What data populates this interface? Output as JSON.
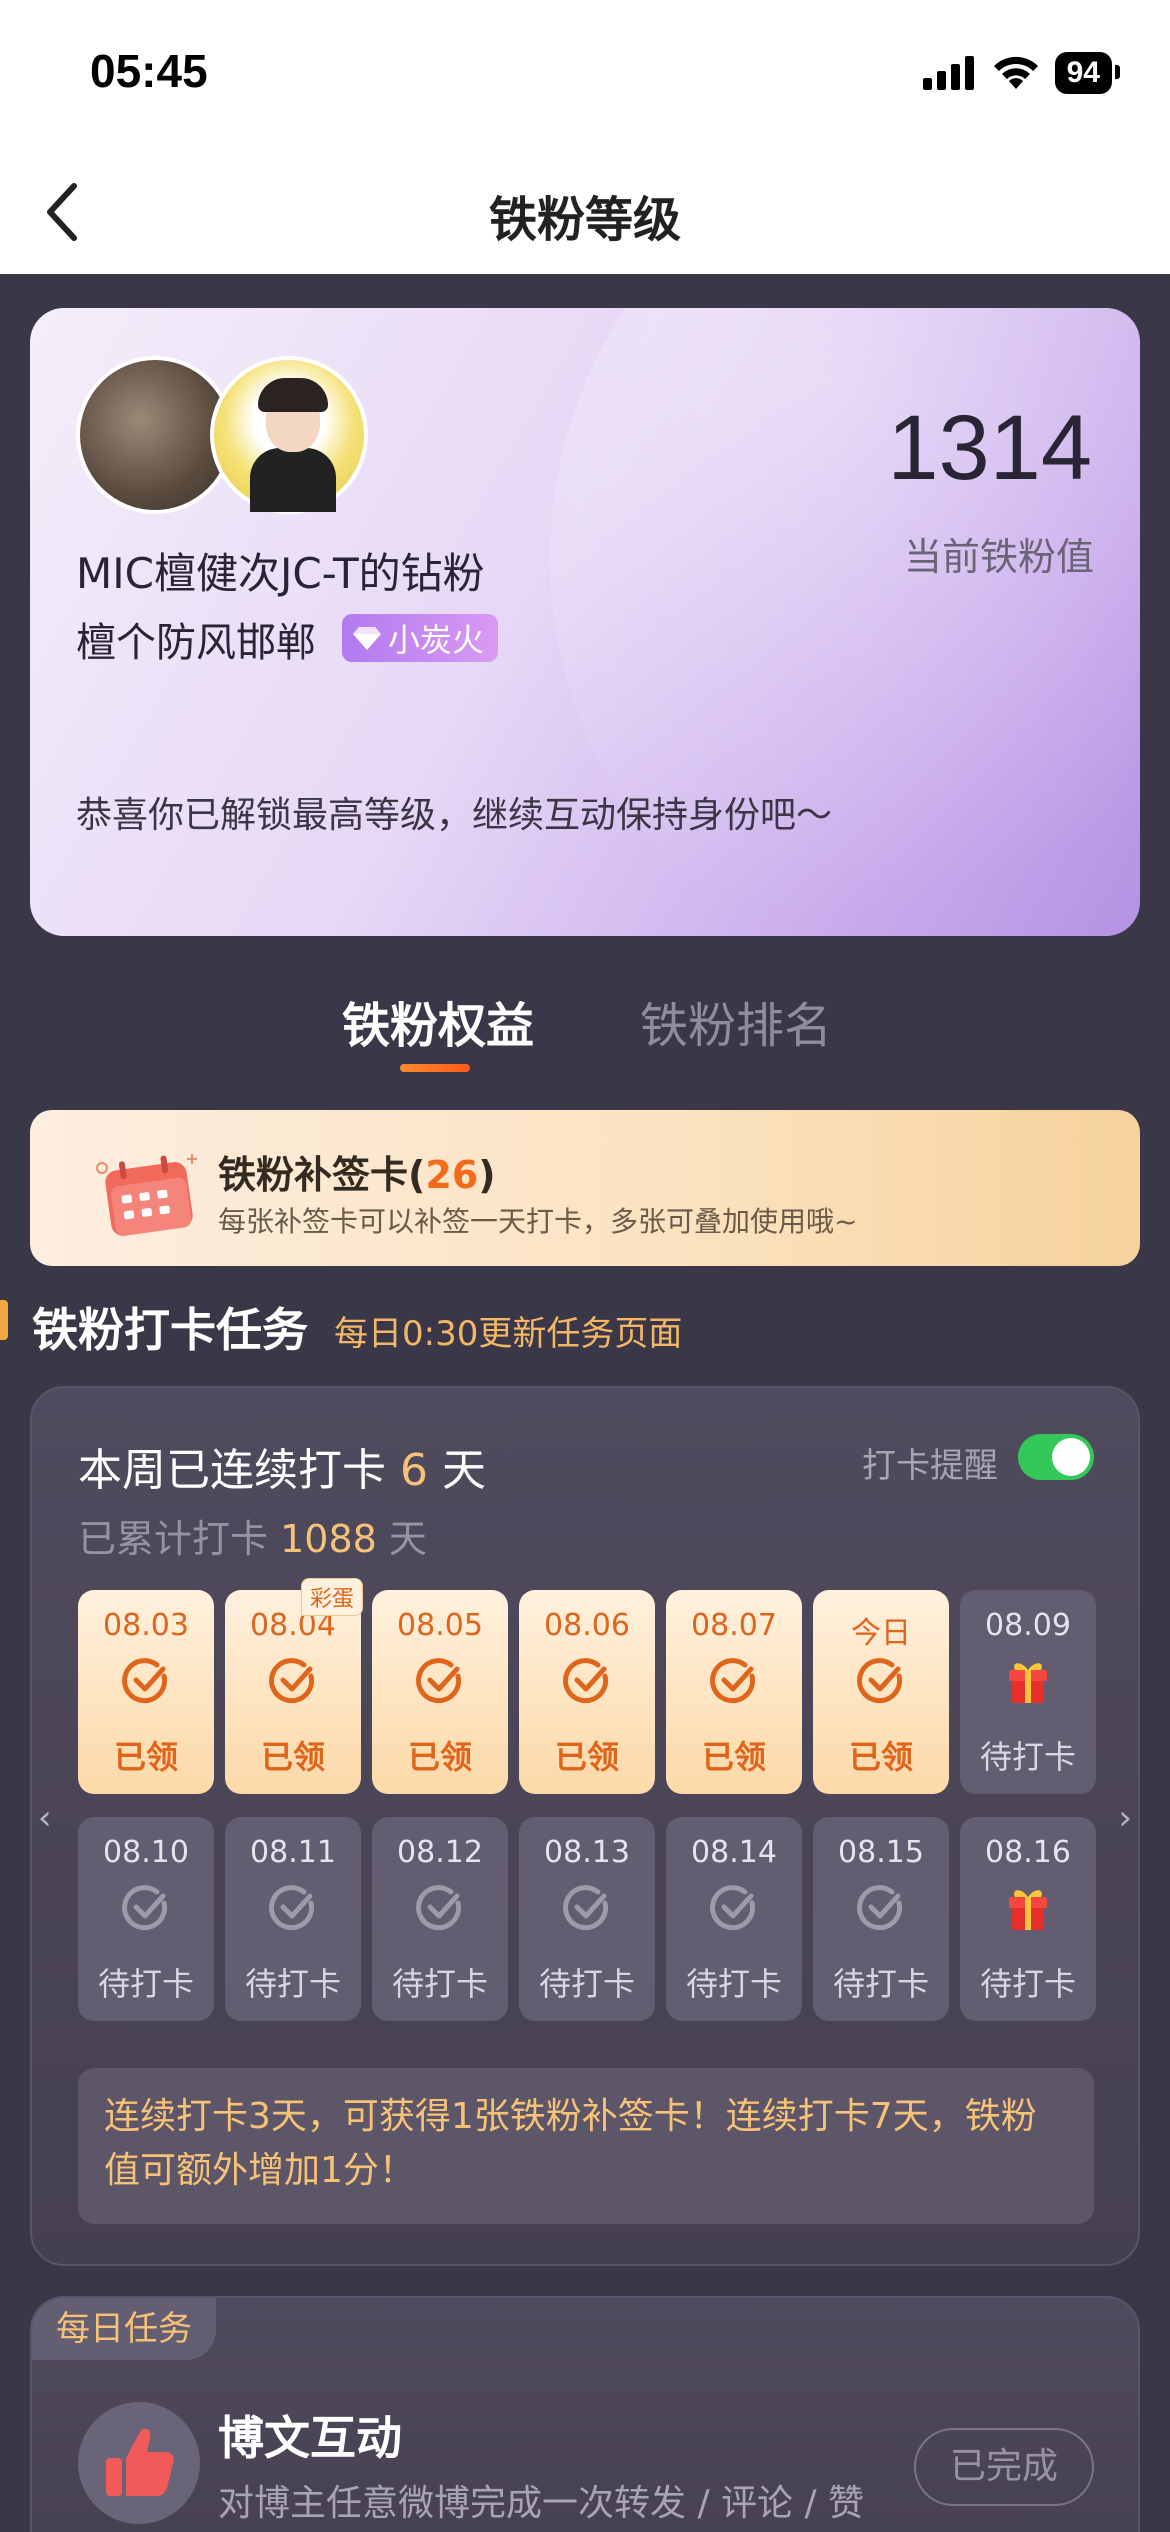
{
  "status_bar": {
    "time": "05:45",
    "battery": "94"
  },
  "header": {
    "title": "铁粉等级"
  },
  "profile": {
    "score": "1314",
    "score_label": "当前铁粉值",
    "fan_title": "MIC檀健次JC-T的钻粉",
    "user_name": "檀个防风邯郸",
    "level_badge": "小炭火",
    "message": "恭喜你已解锁最高等级，继续互动保持身份吧～"
  },
  "tabs": [
    {
      "label": "铁粉权益",
      "active": true
    },
    {
      "label": "铁粉排名",
      "active": false
    }
  ],
  "makeup_card": {
    "title": "铁粉补签卡",
    "count": "26",
    "description": "每张补签卡可以补签一天打卡，多张可叠加使用哦~"
  },
  "checkin_section": {
    "title": "铁粉打卡任务",
    "subtitle": "每日0:30更新任务页面",
    "week_prefix": "本周已连续打卡",
    "week_days": "6",
    "week_suffix": "天",
    "total_prefix": "已累计打卡",
    "total_days": "1088",
    "total_suffix": "天",
    "reminder_label": "打卡提醒",
    "reminder_on": true,
    "egg_tag": "彩蛋",
    "days": [
      {
        "date": "08.03",
        "status": "已领",
        "state": "claimed",
        "icon": "check-icon"
      },
      {
        "date": "08.04",
        "status": "已领",
        "state": "claimed",
        "icon": "check-icon"
      },
      {
        "date": "08.05",
        "status": "已领",
        "state": "claimed",
        "icon": "check-icon"
      },
      {
        "date": "08.06",
        "status": "已领",
        "state": "claimed",
        "icon": "check-icon"
      },
      {
        "date": "08.07",
        "status": "已领",
        "state": "claimed",
        "icon": "check-icon"
      },
      {
        "date": "今日",
        "status": "已领",
        "state": "claimed",
        "icon": "check-icon"
      },
      {
        "date": "08.09",
        "status": "待打卡",
        "state": "pending",
        "icon": "gift-icon"
      },
      {
        "date": "08.10",
        "status": "待打卡",
        "state": "pending",
        "icon": "check-icon"
      },
      {
        "date": "08.11",
        "status": "待打卡",
        "state": "pending",
        "icon": "check-icon"
      },
      {
        "date": "08.12",
        "status": "待打卡",
        "state": "pending",
        "icon": "check-icon"
      },
      {
        "date": "08.13",
        "status": "待打卡",
        "state": "pending",
        "icon": "check-icon"
      },
      {
        "date": "08.14",
        "status": "待打卡",
        "state": "pending",
        "icon": "check-icon"
      },
      {
        "date": "08.15",
        "status": "待打卡",
        "state": "pending",
        "icon": "check-icon"
      },
      {
        "date": "08.16",
        "status": "待打卡",
        "state": "pending",
        "icon": "gift-icon"
      }
    ],
    "rule_text": "连续打卡3天，可获得1张铁粉补签卡！连续打卡7天，铁粉值可额外增加1分！"
  },
  "daily_task": {
    "tag": "每日任务",
    "title": "博文互动",
    "description": "对博主任意微博完成一次转发 / 评论 / 赞",
    "button": "已完成",
    "icon": "thumbs-up-icon"
  },
  "colors": {
    "accent_orange": "#e0651c",
    "gold_text": "#f6c277",
    "toggle_on": "#34c759",
    "background": "#3a3848"
  }
}
